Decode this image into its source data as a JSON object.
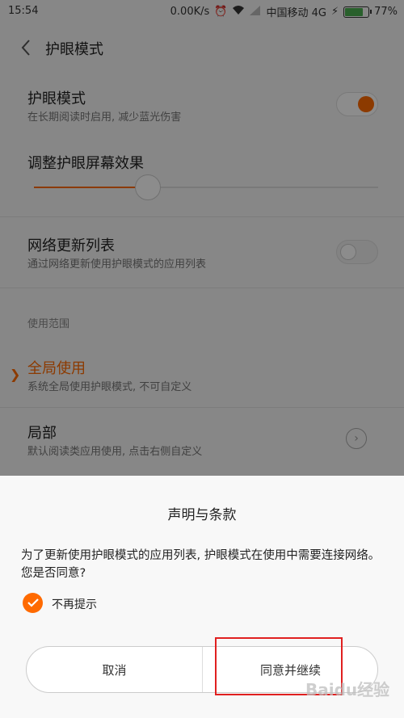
{
  "status_bar": {
    "time": "15:54",
    "network_speed": "0.00K/s",
    "carrier": "中国移动 4G",
    "battery_percent": "77%",
    "battery_level": 0.77,
    "icons": [
      "alarm-icon",
      "wifi-icon",
      "signal-icon",
      "charging-icon",
      "battery-icon"
    ]
  },
  "header": {
    "title": "护眼模式"
  },
  "settings": {
    "eye_mode": {
      "label": "护眼模式",
      "desc": "在长期阅读时启用, 减少蓝光伤害",
      "enabled": true
    },
    "adjust": {
      "label": "调整护眼屏幕效果",
      "level": 0.33
    },
    "network_update": {
      "label": "网络更新列表",
      "desc": "通过网络更新使用护眼模式的应用列表",
      "enabled": false
    },
    "scope_label": "使用范围",
    "global": {
      "label": "全局使用",
      "desc": "系统全局使用护眼模式, 不可自定义",
      "selected": true
    },
    "partial": {
      "label": "局部",
      "desc": "默认阅读类应用使用, 点击右侧自定义",
      "selected": false
    }
  },
  "dialog": {
    "title": "声明与条款",
    "message": "为了更新使用护眼模式的应用列表, 护眼模式在使用中需要连接网络。您是否同意?",
    "checkbox_label": "不再提示",
    "checkbox_checked": true,
    "cancel_label": "取消",
    "agree_label": "同意并继续"
  },
  "colors": {
    "accent": "#ff6a00",
    "highlight_box": "#e02020"
  },
  "watermark": "Baidu经验"
}
